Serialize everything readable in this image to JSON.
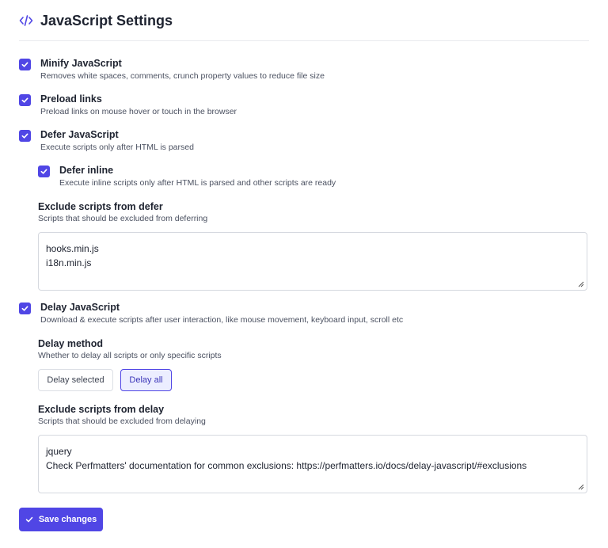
{
  "header": {
    "title": "JavaScript Settings",
    "icon": "code-icon"
  },
  "options": {
    "minify": {
      "label": "Minify JavaScript",
      "description": "Removes white spaces, comments, crunch property values to reduce file size",
      "checked": true
    },
    "preload": {
      "label": "Preload links",
      "description": "Preload links on mouse hover or touch in the browser",
      "checked": true
    },
    "defer": {
      "label": "Defer JavaScript",
      "description": "Execute scripts only after HTML is parsed",
      "checked": true
    },
    "defer_inline": {
      "label": "Defer inline",
      "description": "Execute inline scripts only after HTML is parsed and other scripts are ready",
      "checked": true
    },
    "delay": {
      "label": "Delay JavaScript",
      "description": "Download & execute scripts after user interaction, like mouse movement, keyboard input, scroll etc",
      "checked": true
    }
  },
  "exclude_defer": {
    "label": "Exclude scripts from defer",
    "description": "Scripts that should be excluded from deferring",
    "lines": [
      "hooks.min.js",
      "i18n.min.js"
    ]
  },
  "delay_method": {
    "label": "Delay method",
    "description": "Whether to delay all scripts or only specific scripts",
    "options": [
      "Delay selected",
      "Delay all"
    ],
    "selected": "Delay all"
  },
  "exclude_delay": {
    "label": "Exclude scripts from delay",
    "description": "Scripts that should be excluded from delaying",
    "lines": [
      "jquery",
      "Check Perfmatters' documentation for common exclusions: https://perfmatters.io/docs/delay-javascript/#exclusions"
    ]
  },
  "save": {
    "label": "Save changes",
    "icon": "check-icon"
  },
  "colors": {
    "accent": "#5046e5",
    "selected_bg": "#eceeff",
    "border": "#d5d8df"
  }
}
